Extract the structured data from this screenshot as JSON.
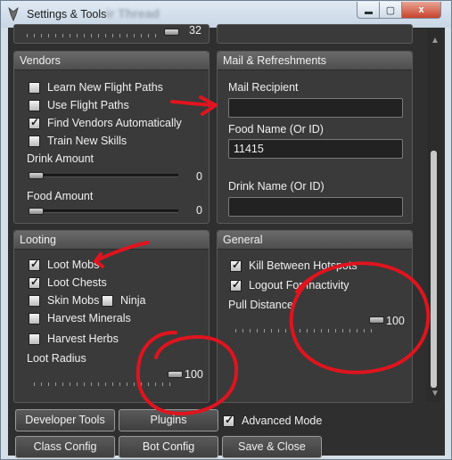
{
  "window": {
    "title": "Settings & Tools",
    "title_ghost": "ir Thread",
    "min_label": "",
    "max_label": "▢",
    "close_label": "x"
  },
  "top_partial": {
    "value": "32"
  },
  "vendors": {
    "header": "Vendors",
    "checkboxes": [
      {
        "label": "Learn New Flight Paths",
        "checked": false
      },
      {
        "label": "Use Flight Paths",
        "checked": false
      },
      {
        "label": "Find Vendors Automatically",
        "checked": true
      },
      {
        "label": "Train New Skills",
        "checked": false
      }
    ],
    "drink_amount_label": "Drink Amount",
    "drink_amount_value": "0",
    "food_amount_label": "Food Amount",
    "food_amount_value": "0"
  },
  "mail": {
    "header": "Mail & Refreshments",
    "mail_recipient_label": "Mail Recipient",
    "mail_recipient_value": "",
    "food_name_label": "Food Name (Or ID)",
    "food_name_value": "11415",
    "drink_name_label": "Drink Name (Or ID)",
    "drink_name_value": ""
  },
  "looting": {
    "header": "Looting",
    "loot_mobs": {
      "label": "Loot Mobs",
      "checked": true
    },
    "loot_chests": {
      "label": "Loot Chests",
      "checked": true
    },
    "skin_mobs": {
      "label": "Skin Mobs",
      "checked": false
    },
    "ninja": {
      "label": "Ninja",
      "checked": false
    },
    "harvest_minerals": {
      "label": "Harvest Minerals",
      "checked": false
    },
    "harvest_herbs": {
      "label": "Harvest Herbs",
      "checked": false
    },
    "loot_radius_label": "Loot Radius",
    "loot_radius_value": "100"
  },
  "general": {
    "header": "General",
    "kill_between_hotspots": {
      "label": "Kill Between Hotspots",
      "checked": true
    },
    "logout_for_inactivity": {
      "label": "Logout For Inactivity",
      "checked": true
    },
    "pull_distance_label": "Pull Distance",
    "pull_distance_value": "100"
  },
  "footer": {
    "developer_tools": "Developer Tools",
    "plugins": "Plugins",
    "advanced_mode": {
      "label": "Advanced Mode",
      "checked": true
    },
    "class_config": "Class Config",
    "bot_config": "Bot Config",
    "save_close": "Save & Close"
  },
  "colors": {
    "annotation": "#e0141e",
    "panel": "#3a3a3a",
    "background": "#2f2f2f"
  }
}
